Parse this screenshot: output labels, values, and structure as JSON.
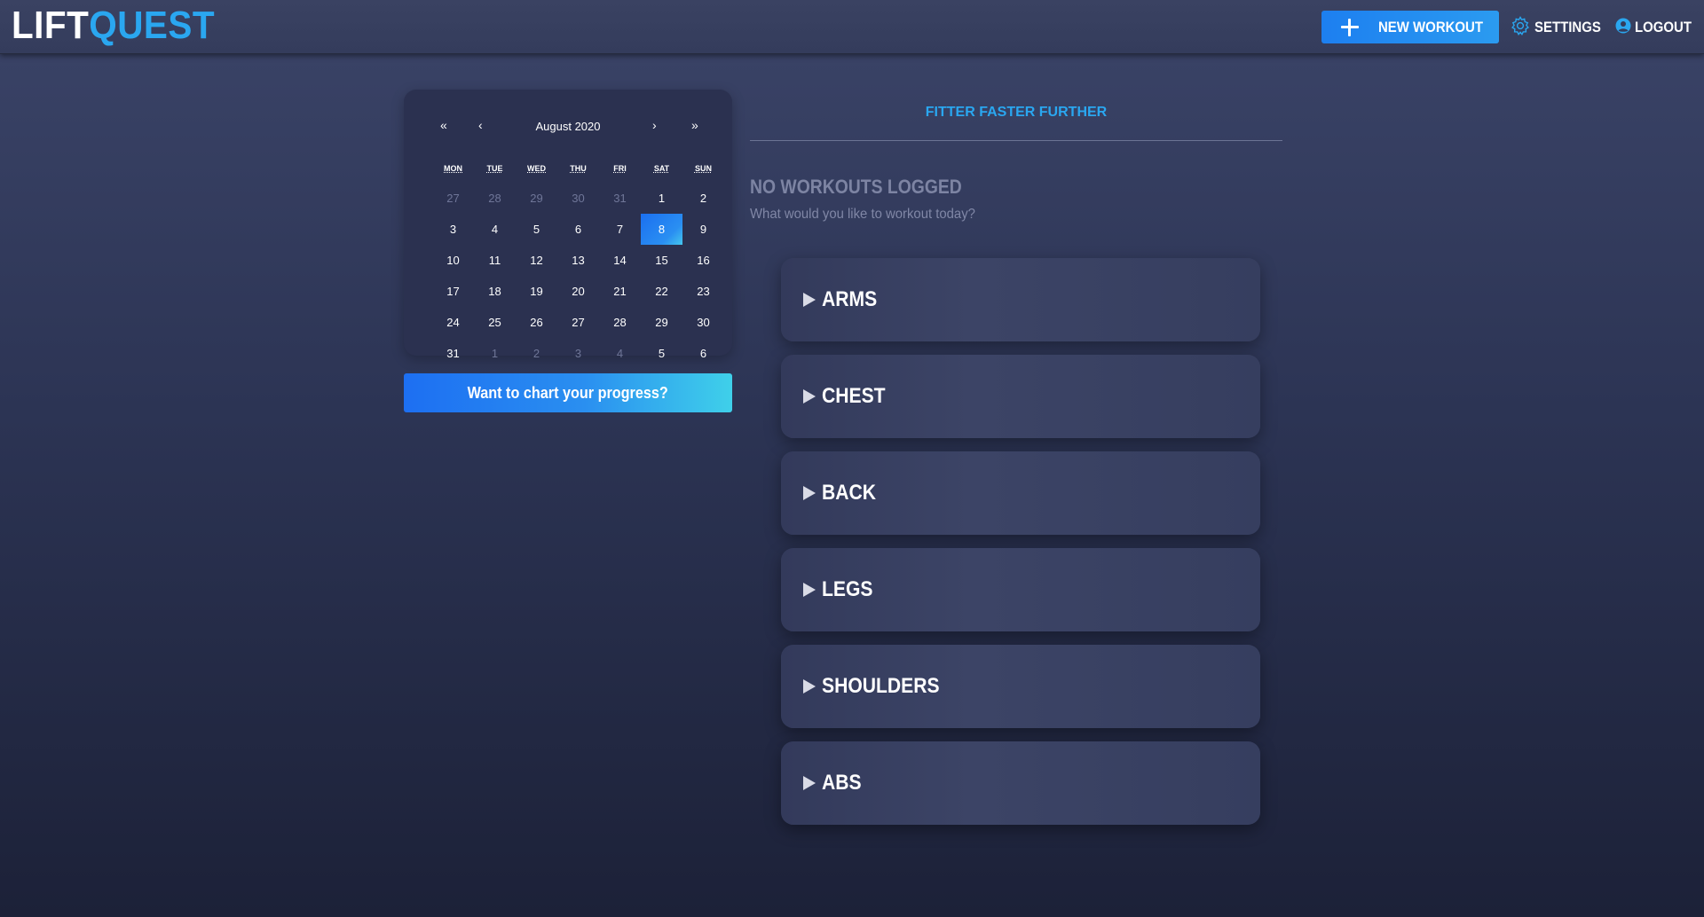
{
  "header": {
    "logo_part1": "LIFT",
    "logo_part2": "QUEST",
    "new_workout_label": "NEW WORKOUT",
    "settings_label": "SETTINGS",
    "logout_label": "LOGOUT"
  },
  "calendar": {
    "nav_prev_year": "«",
    "nav_prev_month": "‹",
    "month_label": "August 2020",
    "nav_next_month": "›",
    "nav_next_year": "»",
    "weekdays": [
      "MON",
      "TUE",
      "WED",
      "THU",
      "FRI",
      "SAT",
      "SUN"
    ],
    "days": [
      {
        "d": "27",
        "muted": true
      },
      {
        "d": "28",
        "muted": true
      },
      {
        "d": "29",
        "muted": true
      },
      {
        "d": "30",
        "muted": true
      },
      {
        "d": "31",
        "muted": true
      },
      {
        "d": "1"
      },
      {
        "d": "2"
      },
      {
        "d": "3"
      },
      {
        "d": "4"
      },
      {
        "d": "5"
      },
      {
        "d": "6"
      },
      {
        "d": "7"
      },
      {
        "d": "8",
        "selected": true
      },
      {
        "d": "9"
      },
      {
        "d": "10"
      },
      {
        "d": "11"
      },
      {
        "d": "12"
      },
      {
        "d": "13"
      },
      {
        "d": "14"
      },
      {
        "d": "15"
      },
      {
        "d": "16"
      },
      {
        "d": "17"
      },
      {
        "d": "18"
      },
      {
        "d": "19"
      },
      {
        "d": "20"
      },
      {
        "d": "21"
      },
      {
        "d": "22"
      },
      {
        "d": "23"
      },
      {
        "d": "24"
      },
      {
        "d": "25"
      },
      {
        "d": "26"
      },
      {
        "d": "27"
      },
      {
        "d": "28"
      },
      {
        "d": "29"
      },
      {
        "d": "30"
      },
      {
        "d": "31"
      },
      {
        "d": "1",
        "muted": true
      },
      {
        "d": "2",
        "muted": true
      },
      {
        "d": "3",
        "muted": true
      },
      {
        "d": "4",
        "muted": true
      },
      {
        "d": "5"
      },
      {
        "d": "6"
      }
    ]
  },
  "chart_progress_label": "Want to chart your progress?",
  "main": {
    "tagline": "FITTER FASTER FURTHER",
    "empty_title": "NO WORKOUTS LOGGED",
    "empty_subtitle": "What would you like to workout today?",
    "muscle_groups": [
      "ARMS",
      "CHEST",
      "BACK",
      "LEGS",
      "SHOULDERS",
      "ABS"
    ]
  },
  "colors": {
    "accent": "#2aa7f0",
    "button_gradient_start": "#1d6ff2",
    "button_gradient_end": "#3fd0ea",
    "card_bg": "#3c4466",
    "page_bg": "#2c3454"
  }
}
